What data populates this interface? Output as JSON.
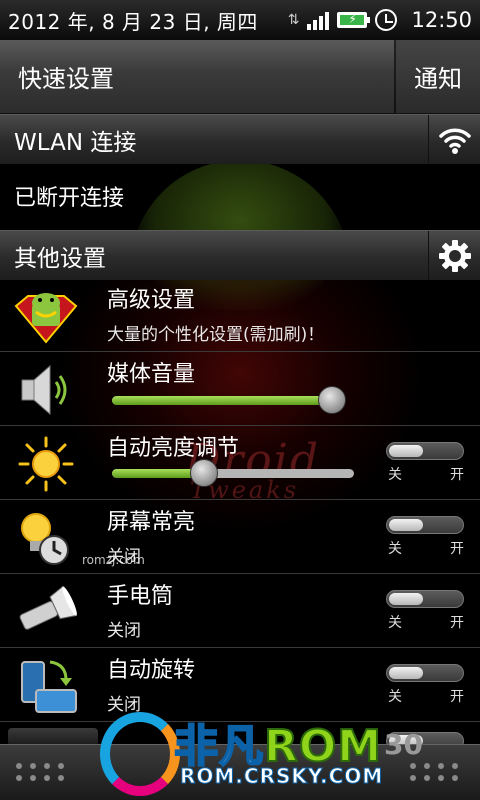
{
  "status_bar": {
    "date": "2012 年, 8 月 23 日, 周四",
    "time": "12:50"
  },
  "header": {
    "quick_settings_tab": "快速设置",
    "notifications_tab": "通知"
  },
  "wlan": {
    "title": "WLAN 连接",
    "status": "已断开连接"
  },
  "other": {
    "title": "其他设置"
  },
  "rows": [
    {
      "title": "高级设置",
      "subtitle": "大量的个性化设置(需加刷)！",
      "icon": "android-superman-icon"
    },
    {
      "title": "媒体音量",
      "icon": "speaker-icon",
      "slider_value": 0.95
    },
    {
      "title": "自动亮度调节",
      "icon": "sun-icon",
      "slider_value": 0.38,
      "off": "关",
      "on": "开"
    },
    {
      "title": "屏幕常亮",
      "subtitle": "关闭",
      "icon": "bulb-clock-icon",
      "off": "关",
      "on": "开"
    },
    {
      "title": "手电筒",
      "subtitle": "关闭",
      "icon": "flashlight-icon",
      "off": "关",
      "on": "开"
    },
    {
      "title": "自动旋转",
      "subtitle": "关闭",
      "icon": "rotate-icon",
      "off": "关",
      "on": "开"
    }
  ],
  "watermark": {
    "site_small": "romzj.com",
    "brand_cn": "非凡",
    "brand_rom": "ROM",
    "brand_url": "ROM.CRSKY.COM",
    "badge": "30",
    "bg_word": "Droid",
    "bg_word2": "Tweaks"
  },
  "colors": {
    "slider_green": "#7cc232",
    "brand_blue": "#18a4e0",
    "brand_green": "#8fd31a"
  }
}
